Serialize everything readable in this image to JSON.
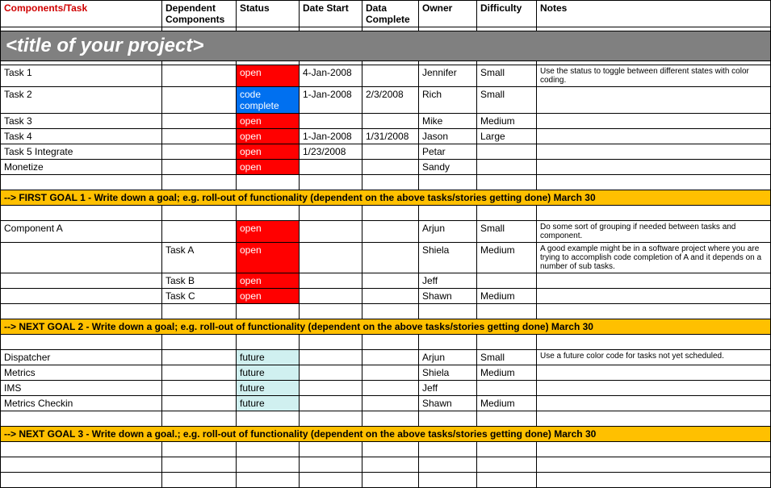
{
  "headers": {
    "task": "Components/Task",
    "dependent": "Dependent Components",
    "status": "Status",
    "start": "Date Start",
    "complete": "Data Complete",
    "owner": "Owner",
    "difficulty": "Difficulty",
    "notes": "Notes"
  },
  "title": "<title of your project>",
  "section1": [
    {
      "task": "Task 1",
      "dep": "",
      "status": "open",
      "statusClass": "status-open",
      "start": "4-Jan-2008",
      "complete": "",
      "owner": "Jennifer",
      "difficulty": "Small",
      "notes": "Use the status to toggle between different states with color coding."
    },
    {
      "task": "Task 2",
      "dep": "",
      "status": "code complete",
      "statusClass": "status-code-complete",
      "start": "1-Jan-2008",
      "complete": "2/3/2008",
      "owner": "Rich",
      "difficulty": "Small",
      "notes": ""
    },
    {
      "task": "Task 3",
      "dep": "",
      "status": "open",
      "statusClass": "status-open",
      "start": "",
      "complete": "",
      "owner": "Mike",
      "difficulty": "Medium",
      "notes": ""
    },
    {
      "task": "Task 4",
      "dep": "",
      "status": "open",
      "statusClass": "status-open",
      "start": "1-Jan-2008",
      "complete": "1/31/2008",
      "owner": "Jason",
      "difficulty": "Large",
      "notes": ""
    },
    {
      "task": "Task 5 Integrate",
      "dep": "",
      "status": "open",
      "statusClass": "status-open",
      "start": "1/23/2008",
      "complete": "",
      "owner": "Petar",
      "difficulty": "",
      "notes": ""
    },
    {
      "task": "Monetize",
      "dep": "",
      "status": "open",
      "statusClass": "status-open",
      "start": "",
      "complete": "",
      "owner": "Sandy",
      "difficulty": "",
      "notes": ""
    }
  ],
  "goal1": "--> FIRST GOAL 1 - Write down a goal; e.g. roll-out of functionality (dependent on the above tasks/stories getting done) March 30",
  "section2": [
    {
      "task": "Component A",
      "dep": "",
      "status": "open",
      "statusClass": "status-open",
      "start": "",
      "complete": "",
      "owner": "Arjun",
      "difficulty": "Small",
      "notes": "Do some sort of grouping if needed between tasks and component."
    },
    {
      "task": "",
      "dep": "Task A",
      "status": "open",
      "statusClass": "status-open",
      "start": "",
      "complete": "",
      "owner": "Shiela",
      "difficulty": "Medium",
      "notes": "A good example might be in a software project where you are trying to accomplish code completion of A and it depends on a number of sub tasks."
    },
    {
      "task": "",
      "dep": "Task B",
      "status": "open",
      "statusClass": "status-open",
      "start": "",
      "complete": "",
      "owner": "Jeff",
      "difficulty": "",
      "notes": ""
    },
    {
      "task": "",
      "dep": "Task C",
      "status": "open",
      "statusClass": "status-open",
      "start": "",
      "complete": "",
      "owner": "Shawn",
      "difficulty": "Medium",
      "notes": ""
    }
  ],
  "goal2": "--> NEXT GOAL 2 - Write down a goal; e.g. roll-out of functionality (dependent on the above tasks/stories getting done) March 30",
  "section3": [
    {
      "task": "Dispatcher",
      "dep": "",
      "status": "future",
      "statusClass": "status-future",
      "start": "",
      "complete": "",
      "owner": "Arjun",
      "difficulty": "Small",
      "notes": "Use a future color code for tasks not yet scheduled."
    },
    {
      "task": "Metrics",
      "dep": "",
      "status": "future",
      "statusClass": "status-future",
      "start": "",
      "complete": "",
      "owner": "Shiela",
      "difficulty": "Medium",
      "notes": ""
    },
    {
      "task": "IMS",
      "dep": "",
      "status": "future",
      "statusClass": "status-future",
      "start": "",
      "complete": "",
      "owner": "Jeff",
      "difficulty": "",
      "notes": ""
    },
    {
      "task": "Metrics Checkin",
      "dep": "",
      "status": "future",
      "statusClass": "status-future",
      "start": "",
      "complete": "",
      "owner": "Shawn",
      "difficulty": "Medium",
      "notes": ""
    }
  ],
  "goal3": "--> NEXT GOAL 3 - Write down a goal.; e.g. roll-out of functionality (dependent on the above tasks/stories getting done) March 30"
}
